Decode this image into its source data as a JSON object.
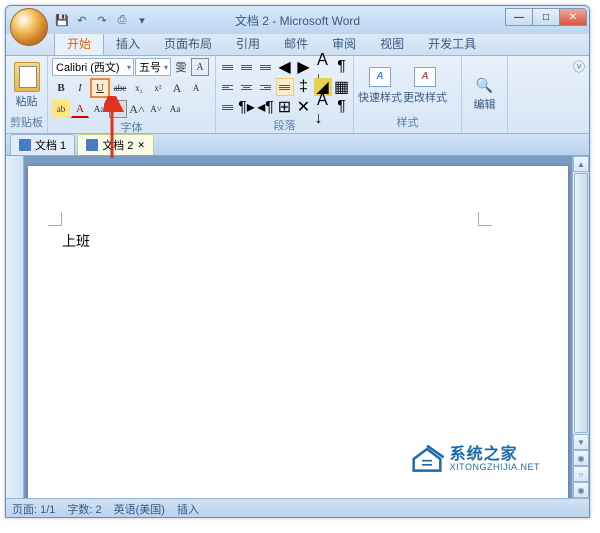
{
  "window": {
    "title": "文档 2 - Microsoft Word",
    "min": "—",
    "max": "□",
    "close": "✕"
  },
  "qat": {
    "save": "💾",
    "undo": "↶",
    "redo": "↷",
    "print": "⎙"
  },
  "tabs": {
    "home": "开始",
    "insert": "插入",
    "layout": "页面布局",
    "refs": "引用",
    "mail": "邮件",
    "review": "审阅",
    "view": "视图",
    "dev": "开发工具"
  },
  "ribbon": {
    "clipboard": {
      "label": "剪贴板",
      "paste": "粘贴"
    },
    "font": {
      "label": "字体",
      "name": "Calibri (西文)",
      "size": "五号",
      "bold": "B",
      "italic": "I",
      "underline": "U",
      "strike": "abe",
      "sub": "x₂",
      "sup": "x²",
      "highlight": "ab",
      "color": "A",
      "clear": "Aa",
      "grow": "A",
      "shrink": "A",
      "case": "Aa",
      "charborder": "A",
      "phonetic": "雯"
    },
    "para": {
      "label": "段落"
    },
    "styles": {
      "label": "样式",
      "quick": "快速样式",
      "change": "更改样式"
    },
    "editing": {
      "label": "编辑"
    },
    "min": "ⓥ"
  },
  "doctabs": {
    "t1": "文档 1",
    "t2": "文档 2",
    "close": "✕"
  },
  "document": {
    "text": "上班",
    "underline_tail": "    "
  },
  "watermark": {
    "cn": "系统之家",
    "en": "XITONGZHIJIA.NET"
  },
  "status": {
    "page": "页面: 1/1",
    "words": "字数: 2",
    "lang": "英语(美国)",
    "insert": "插入"
  }
}
